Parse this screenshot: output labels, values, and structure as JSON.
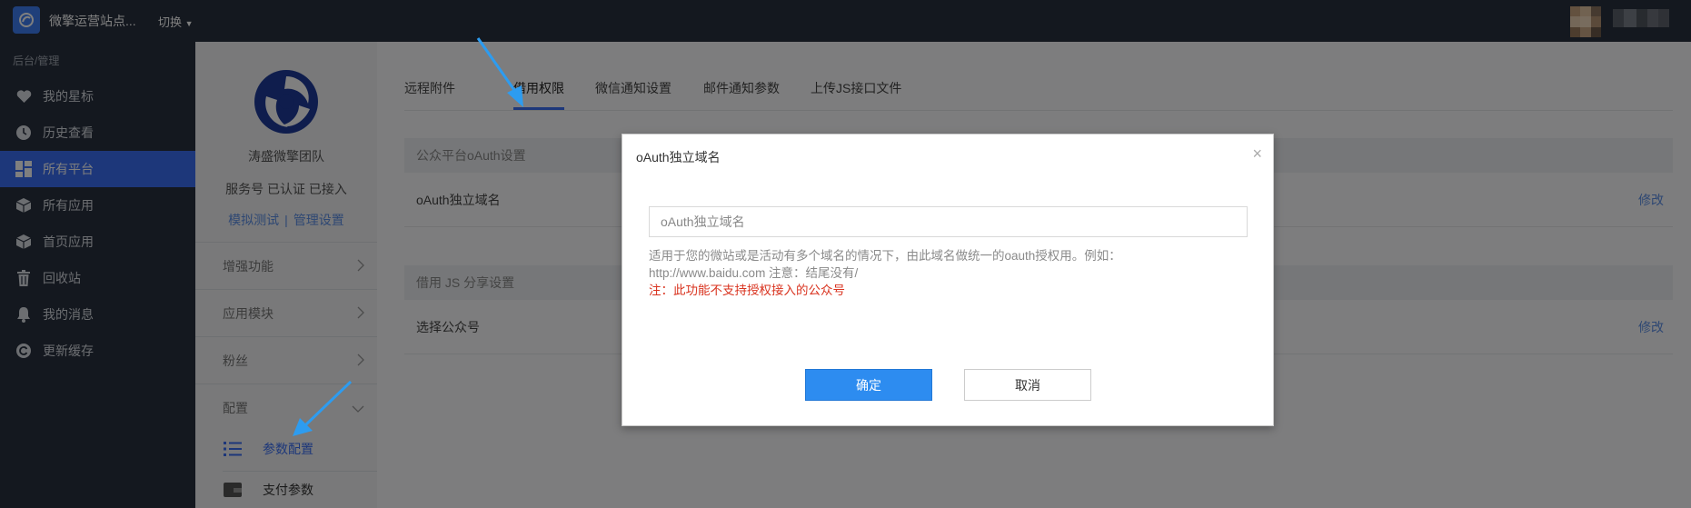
{
  "topbar": {
    "title": "微擎运营站点...",
    "switch_label": "切换"
  },
  "sidebar": {
    "heading": "后台/管理",
    "items": [
      {
        "label": "我的星标",
        "icon": "heart-icon"
      },
      {
        "label": "历史查看",
        "icon": "clock-icon"
      },
      {
        "label": "所有平台",
        "icon": "grid-icon",
        "active": true
      },
      {
        "label": "所有应用",
        "icon": "cube-icon"
      },
      {
        "label": "首页应用",
        "icon": "cube-icon"
      },
      {
        "label": "回收站",
        "icon": "trash-icon"
      },
      {
        "label": "我的消息",
        "icon": "bell-icon"
      },
      {
        "label": "更新缓存",
        "icon": "refresh-icon"
      }
    ]
  },
  "account": {
    "name": "涛盛微擎团队",
    "status": "服务号 已认证 已接入",
    "link_test": "模拟测试",
    "link_separator": "|",
    "link_manage": "管理设置",
    "menu": [
      {
        "label": "增强功能"
      },
      {
        "label": "应用模块"
      },
      {
        "label": "粉丝"
      },
      {
        "label": "配置"
      }
    ],
    "sub_items": [
      {
        "label": "参数配置",
        "active": true
      },
      {
        "label": "支付参数"
      }
    ]
  },
  "tabs": [
    {
      "label": "远程附件"
    },
    {
      "label": "借用权限",
      "active": true
    },
    {
      "label": "微信通知设置"
    },
    {
      "label": "邮件通知参数"
    },
    {
      "label": "上传JS接口文件"
    }
  ],
  "sections": [
    {
      "head": "公众平台oAuth设置",
      "row_label": "oAuth独立域名",
      "edit": "修改"
    },
    {
      "head": "借用 JS 分享设置",
      "row_label": "选择公众号",
      "edit": "修改"
    }
  ],
  "modal": {
    "title": "oAuth独立域名",
    "close": "×",
    "input_placeholder": "oAuth独立域名",
    "input_value": "",
    "help_line1": "适用于您的微站或是活动有多个域名的情况下，由此域名做统一的oauth授权用。例如：",
    "help_line2": "http://www.baidu.com 注意：结尾没有/",
    "warning": "注：此功能不支持授权接入的公众号",
    "ok_label": "确定",
    "cancel_label": "取消"
  },
  "colors": {
    "topbar_bg": "#28303f",
    "active_nav": "#3a6ff5",
    "link": "#5c8fe6",
    "primary_button": "#2d8cf0",
    "warning_text": "#d9331f",
    "arrow": "#2d9cf0"
  }
}
